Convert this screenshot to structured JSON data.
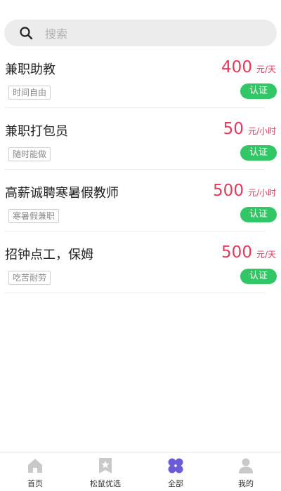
{
  "search": {
    "placeholder": "搜索"
  },
  "jobs": [
    {
      "title": "兼职助教",
      "price": "400",
      "unit": "元/天",
      "tag": "时间自由",
      "badge": "认证"
    },
    {
      "title": "兼职打包员",
      "price": "50",
      "unit": "元/小时",
      "tag": "随时能做",
      "badge": "认证"
    },
    {
      "title": "高薪诚聘寒暑假教师",
      "price": "500",
      "unit": "元/小时",
      "tag": "寒暑假兼职",
      "badge": "认证"
    },
    {
      "title": "招钟点工，保姆",
      "price": "500",
      "unit": "元/天",
      "tag": "吃苦耐劳",
      "badge": "认证"
    }
  ],
  "tabbar": {
    "items": [
      {
        "label": "首页",
        "icon": "home-icon"
      },
      {
        "label": "松鼠优选",
        "icon": "star-bookmark-icon"
      },
      {
        "label": "全部",
        "icon": "clover-icon",
        "active": true
      },
      {
        "label": "我的",
        "icon": "user-icon"
      }
    ]
  },
  "colors": {
    "price": "#e5395a",
    "badge": "#33c667",
    "active_tab": "#6b5bd6",
    "inactive_tab": "#c9c9c9"
  }
}
